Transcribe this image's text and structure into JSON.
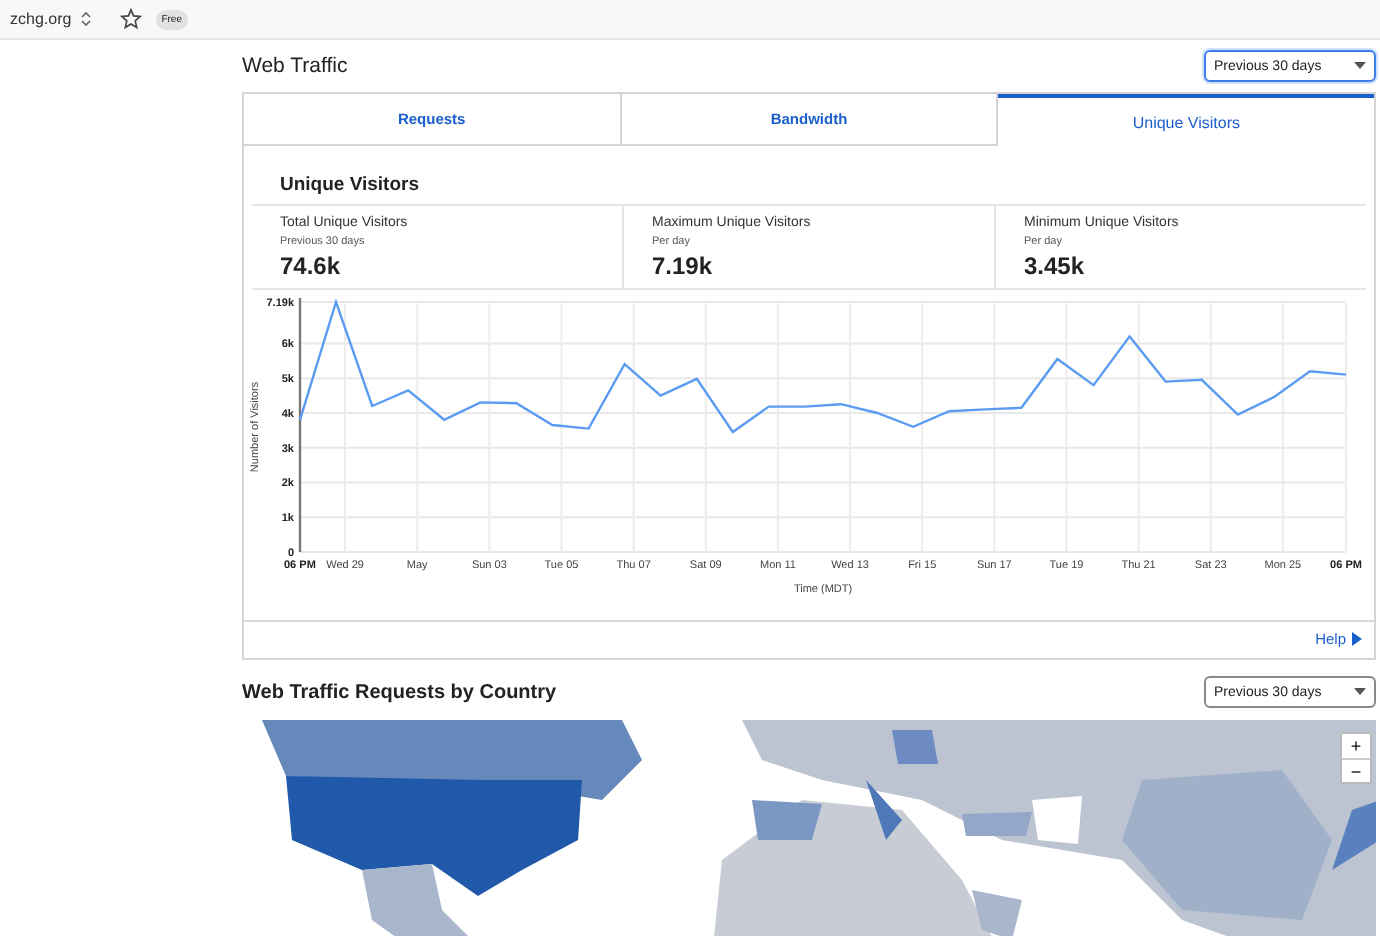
{
  "browser_bar": {
    "domain": "zchg.org",
    "badge": "Free"
  },
  "web_traffic": {
    "title": "Web Traffic",
    "range_select": "Previous 30 days",
    "tabs": [
      {
        "label": "Requests",
        "selected": false
      },
      {
        "label": "Bandwidth",
        "selected": false
      },
      {
        "label": "Unique Visitors",
        "selected": true
      }
    ],
    "panel_title": "Unique Visitors",
    "stats": [
      {
        "label": "Total Unique Visitors",
        "sub": "Previous 30 days",
        "value": "74.6k"
      },
      {
        "label": "Maximum Unique Visitors",
        "sub": "Per day",
        "value": "7.19k"
      },
      {
        "label": "Minimum Unique Visitors",
        "sub": "Per day",
        "value": "3.45k"
      }
    ],
    "chart_data": {
      "type": "line",
      "xlabel": "Time (MDT)",
      "ylabel": "Number of Visitors",
      "categories": [
        "06 PM",
        "Wed 29",
        null,
        "May",
        null,
        "Sun 03",
        null,
        "Tue 05",
        null,
        "Thu 07",
        null,
        "Sat 09",
        null,
        "Mon 11",
        null,
        "Wed 13",
        null,
        "Fri 15",
        null,
        "Sun 17",
        null,
        "Tue 19",
        null,
        "Thu 21",
        null,
        "Sat 23",
        null,
        "Mon 25",
        null,
        "06 PM"
      ],
      "grid": true,
      "series": [
        {
          "color": "#5b9cf2",
          "values": [
            3800,
            7190,
            4200,
            4650,
            3800,
            4300,
            4280,
            3650,
            3550,
            5400,
            4500,
            4980,
            3450,
            4180,
            4180,
            4250,
            4000,
            3600,
            4050,
            4100,
            4150,
            5550,
            4800,
            6200,
            4900,
            4950,
            3950,
            4450,
            5200,
            5100
          ]
        }
      ],
      "ylim": [
        0,
        7190
      ],
      "yticks": [
        0,
        {
          "value": 1000,
          "label": "1k"
        },
        {
          "value": 2000,
          "label": "2k"
        },
        {
          "value": 3000,
          "label": "3k"
        },
        {
          "value": 4000,
          "label": "4k"
        },
        {
          "value": 5000,
          "label": "5k"
        },
        {
          "value": 6000,
          "label": "6k"
        },
        {
          "value": 7190,
          "label": "7.19k"
        }
      ]
    },
    "help_link": "Help"
  },
  "by_country": {
    "title": "Web Traffic Requests by Country",
    "range_select": "Previous 30 days",
    "map": {
      "kind": "picture",
      "zoom_in": "+",
      "zoom_out": "−"
    }
  }
}
